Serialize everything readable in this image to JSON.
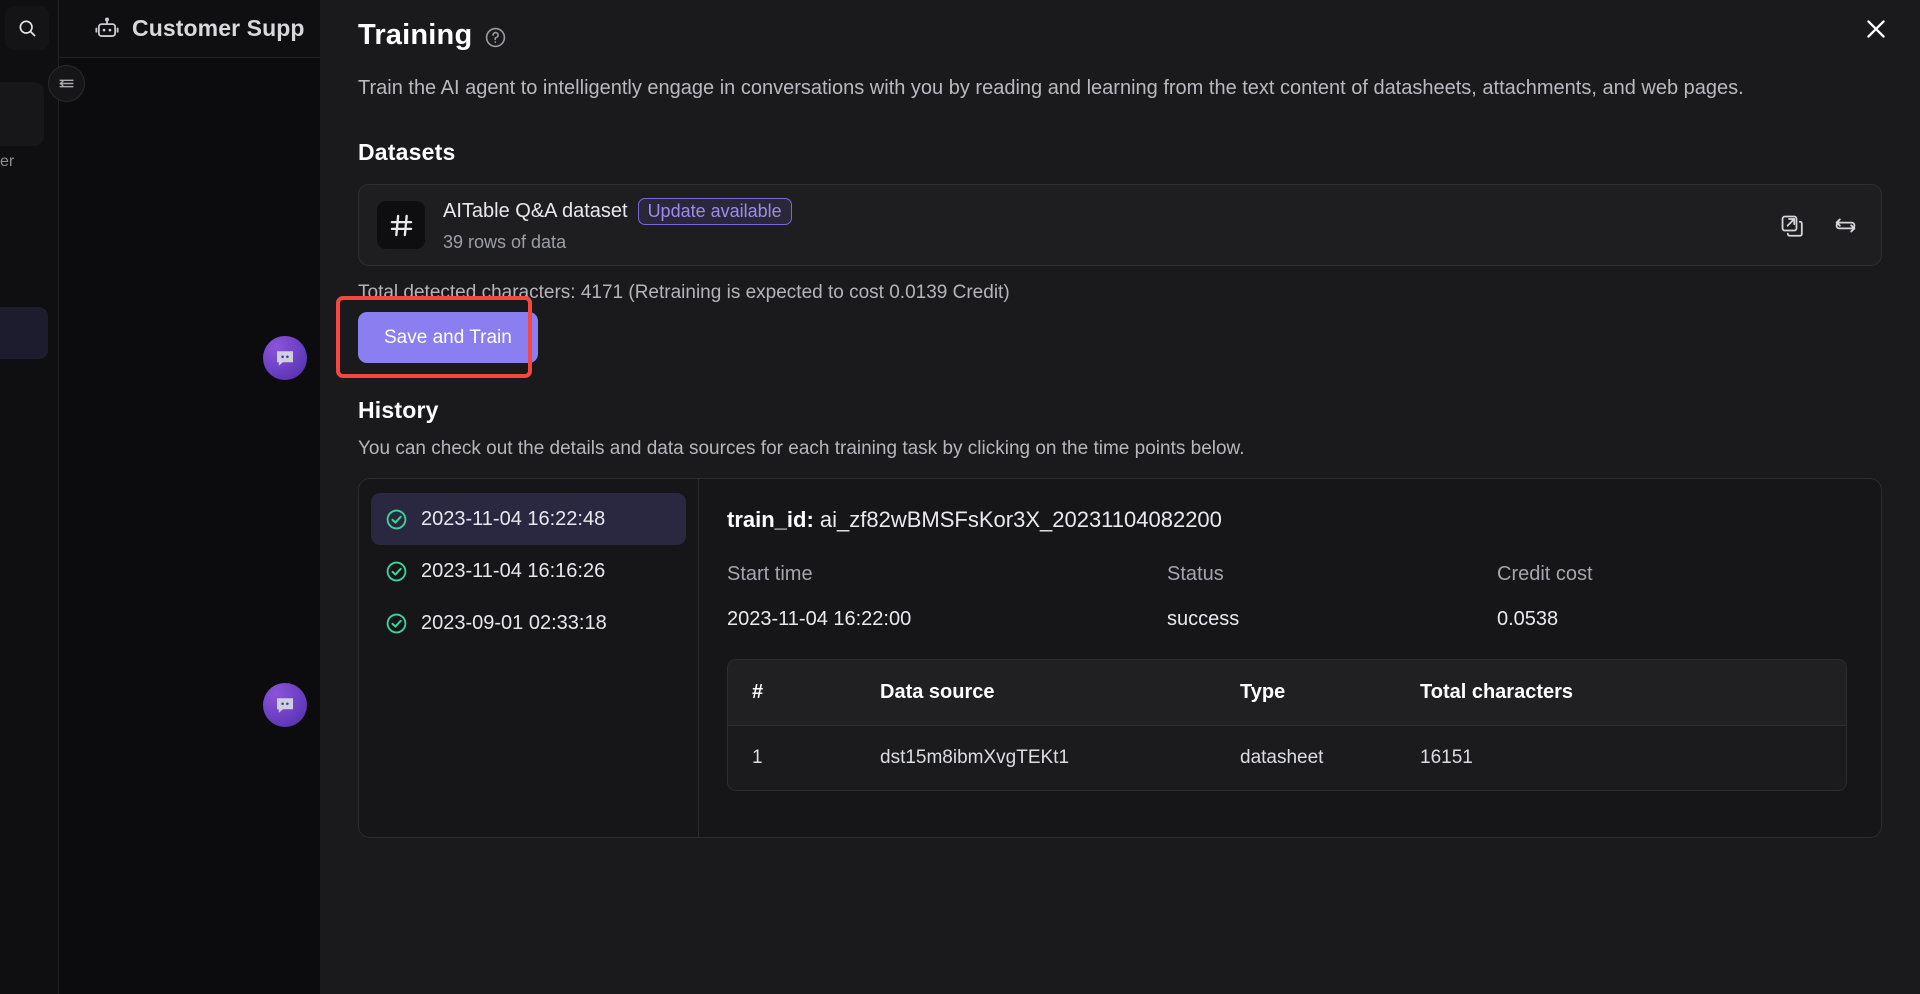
{
  "background": {
    "search_icon": "search-icon",
    "robot_icon": "robot-icon",
    "app_title": "Customer Supp",
    "rail_label": "er",
    "collapse_icon": "collapse-sidebar-icon",
    "avatar_icon": "chat-bubble-icon"
  },
  "modal": {
    "title": "Training",
    "help_icon": "question-mark-circle-icon",
    "close_icon": "close-icon",
    "intro": "Train the AI agent to intelligently engage in conversations with you by reading and learning from the text content of datasheets, attachments, and web pages.",
    "datasets": {
      "section_title": "Datasets",
      "thumb_icon": "hash-grid-icon",
      "name": "AITable Q&A dataset",
      "badge": "Update available",
      "rows_text": "39 rows of data",
      "open_icon": "open-in-new-icon",
      "sync_icon": "sync-refresh-icon",
      "total_characters_text": "Total detected characters: 4171 (Retraining is expected to cost 0.0139 Credit)",
      "save_train_label": "Save and Train",
      "highlight_color": "#f4473d",
      "button_color": "#8b7ef0",
      "badge_color": "#9d8bf0"
    },
    "history": {
      "section_title": "History",
      "description": "You can check out the details and data sources for each training task by clicking on the time points below.",
      "items": [
        {
          "timestamp": "2023-11-04 16:22:48",
          "status_icon": "check-circle-icon",
          "active": true
        },
        {
          "timestamp": "2023-11-04 16:16:26",
          "status_icon": "check-circle-icon",
          "active": false
        },
        {
          "timestamp": "2023-09-01 02:33:18",
          "status_icon": "check-circle-icon",
          "active": false
        }
      ],
      "status_color": "#3fd49a",
      "detail": {
        "train_id_label": "train_id:",
        "train_id_value": "ai_zf82wBMSFsKor3X_20231104082200",
        "start_time_label": "Start time",
        "start_time_value": "2023-11-04 16:22:00",
        "status_label": "Status",
        "status_value": "success",
        "credit_cost_label": "Credit cost",
        "credit_cost_value": "0.0538",
        "table": {
          "headers": [
            "#",
            "Data source",
            "Type",
            "Total characters"
          ],
          "rows": [
            {
              "index": "1",
              "source": "dst15m8ibmXvgTEKt1",
              "type": "datasheet",
              "total_characters": "16151"
            }
          ]
        }
      }
    }
  }
}
